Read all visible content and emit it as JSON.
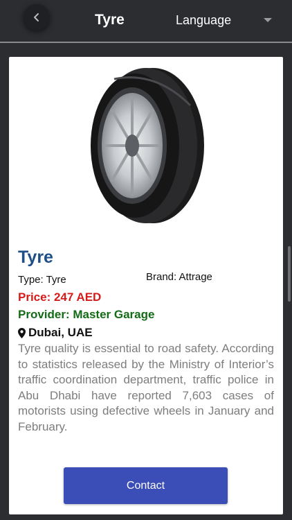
{
  "header": {
    "title": "Tyre",
    "language_label": "Language",
    "back_icon": "chevron-left-icon",
    "language_icon": "caret-down-icon"
  },
  "product": {
    "image_icon": "tyre-image",
    "name": "Tyre",
    "type": "Type: Tyre",
    "brand": "Brand: Attrage",
    "price": "Price: 247 AED",
    "provider": "Provider: Master Garage",
    "location_icon": "map-marker-icon",
    "location": "Dubai, UAE",
    "description": "Tyre quality is essential to road safety. According to statistics released by the Ministry of Interior’s traffic coordination department, traffic police in Abu Dhabi have reported 7,603 cases of motorists using defective wheels in January and February."
  },
  "actions": {
    "contact_label": "Contact"
  },
  "colors": {
    "background": "#2b2d31",
    "title": "#1e4f86",
    "price": "#d61a1a",
    "provider": "#136b17",
    "button": "#3b4db6"
  }
}
